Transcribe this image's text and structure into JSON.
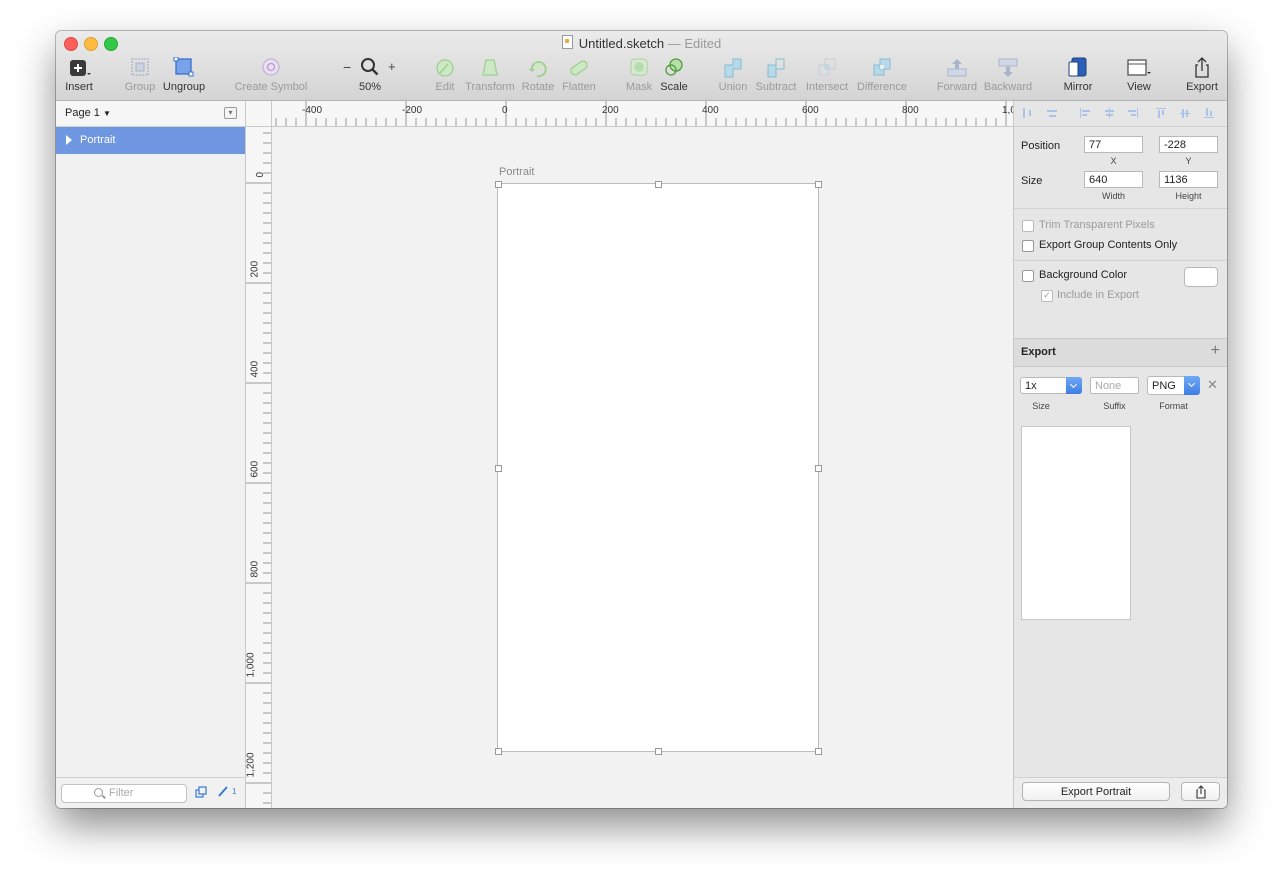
{
  "window": {
    "filename": "Untitled.sketch",
    "separator": "—",
    "status": "Edited"
  },
  "toolbar": {
    "insert": "Insert",
    "group": "Group",
    "ungroup": "Ungroup",
    "create_symbol": "Create Symbol",
    "zoom_minus": "−",
    "zoom_plus": "+",
    "zoom_level": "50%",
    "edit": "Edit",
    "transform": "Transform",
    "rotate": "Rotate",
    "flatten": "Flatten",
    "mask": "Mask",
    "scale": "Scale",
    "union": "Union",
    "subtract": "Subtract",
    "intersect": "Intersect",
    "difference": "Difference",
    "forward": "Forward",
    "backward": "Backward",
    "mirror": "Mirror",
    "view": "View",
    "export": "Export"
  },
  "sidebar": {
    "page_name": "Page 1",
    "layers": [
      {
        "label": "Portrait"
      }
    ],
    "filter_placeholder": "Filter",
    "slice_count": "1"
  },
  "rulers": {
    "horizontal": [
      "-400",
      "-200",
      "0",
      "200",
      "400",
      "600",
      "800",
      "1,0"
    ],
    "vertical": [
      "0",
      "200",
      "400",
      "600",
      "800",
      "1,000",
      "1,200"
    ]
  },
  "canvas": {
    "artboard_name": "Portrait"
  },
  "inspector": {
    "position_label": "Position",
    "x_value": "77",
    "y_value": "-228",
    "x_label": "X",
    "y_label": "Y",
    "size_label": "Size",
    "width_value": "640",
    "height_value": "1136",
    "width_label": "Width",
    "height_label": "Height",
    "trim_label": "Trim Transparent Pixels",
    "export_group_label": "Export Group Contents Only",
    "bg_color_label": "Background Color",
    "include_export_label": "Include in Export",
    "export_title": "Export",
    "export_size_value": "1x",
    "suffix_placeholder": "None",
    "format_value": "PNG",
    "size_caption": "Size",
    "suffix_caption": "Suffix",
    "format_caption": "Format",
    "export_button": "Export Portrait"
  }
}
